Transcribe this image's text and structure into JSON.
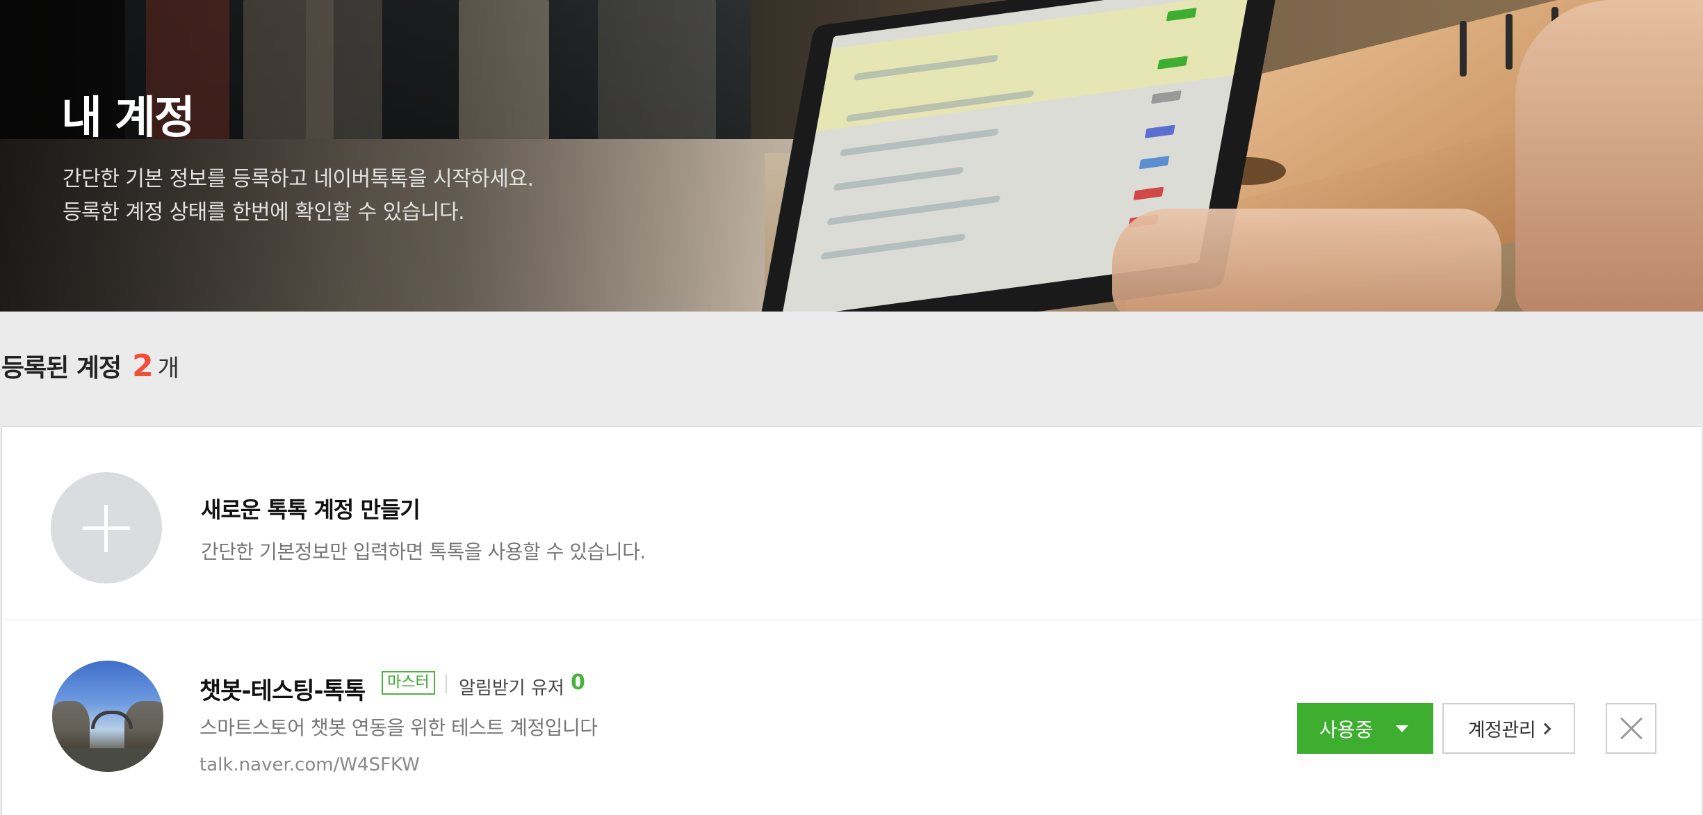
{
  "hero": {
    "title": "내 계정",
    "desc_line1": "간단한 기본 정보를  등록하고 네이버톡톡을 시작하세요.",
    "desc_line2": "등록한 계정 상태를 한번에 확인할 수 있습니다."
  },
  "accounts_summary": {
    "label": "등록된 계정",
    "count": "2",
    "unit": "개"
  },
  "new_account": {
    "icon": "plus-icon",
    "title": "새로운 톡톡 계정 만들기",
    "description": "간단한 기본정보만 입력하면 톡톡을 사용할 수 있습니다."
  },
  "account": {
    "name": "챗봇-테스팅-톡톡",
    "role_badge": "마스터",
    "notify_label": "알림받기 유저",
    "notify_count": "0",
    "description": "스마트스토어 챗봇 연동을 위한 테스트 계정입니다",
    "url": "talk.naver.com/W4SFKW",
    "status_button": "사용중",
    "manage_button": "계정관리",
    "close_icon": "close-icon"
  },
  "colors": {
    "accent_green": "#3dae30",
    "count_red": "#f04f3c",
    "page_bg": "#ebebeb"
  }
}
